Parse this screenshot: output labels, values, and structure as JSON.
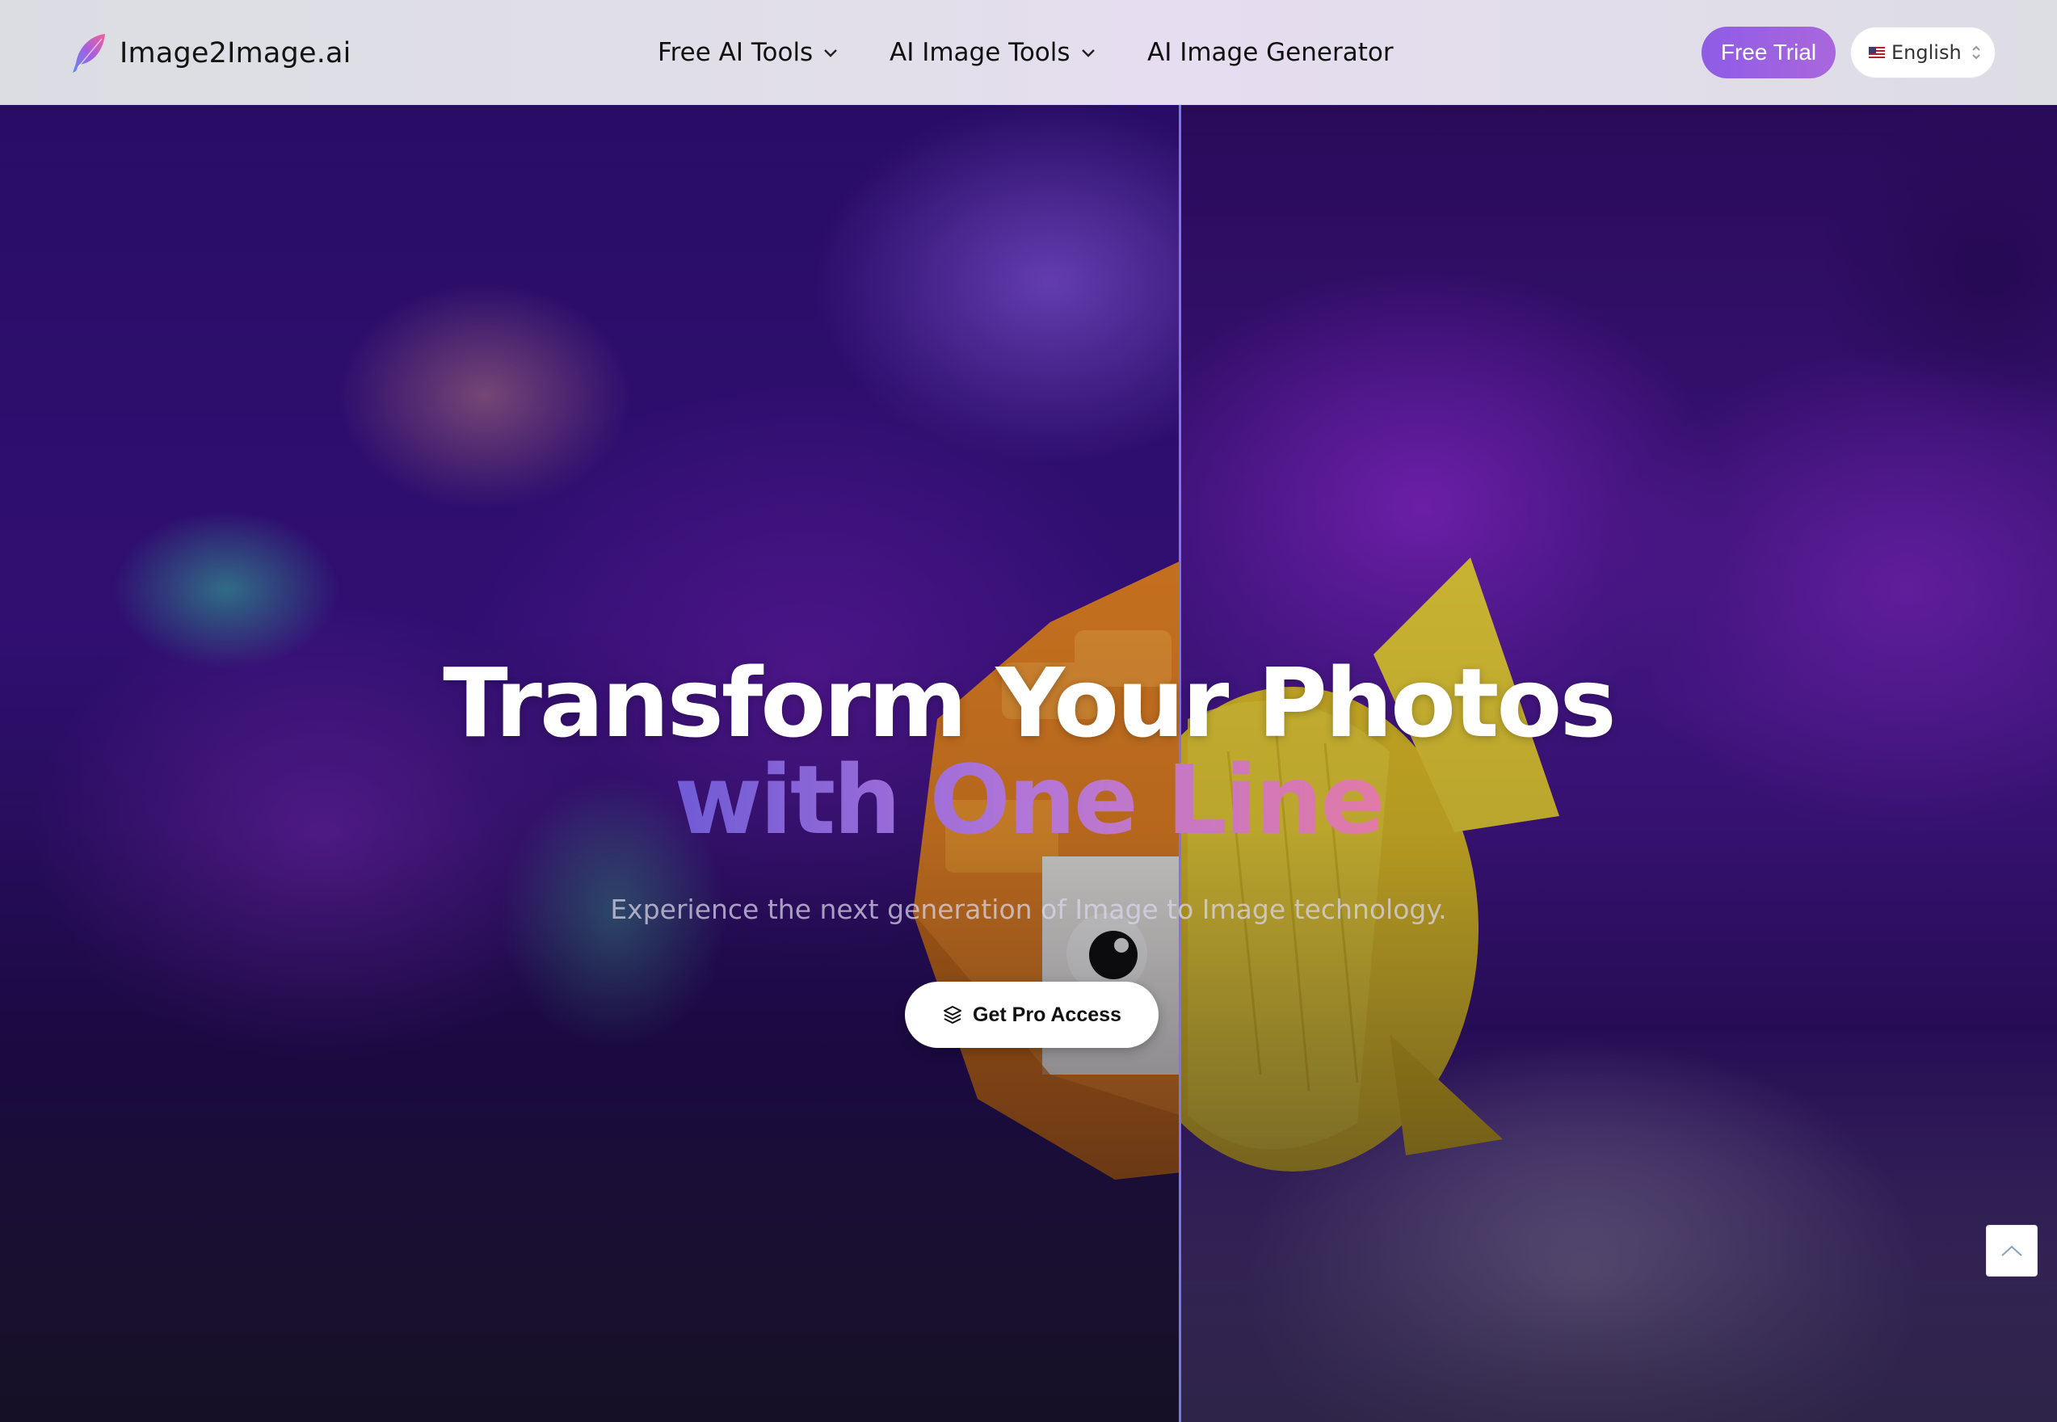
{
  "header": {
    "brand": "Image2Image.ai",
    "nav": [
      {
        "label": "Free AI Tools",
        "icon": "chevron-down-icon"
      },
      {
        "label": "AI Image Tools",
        "icon": "chevron-down-icon"
      },
      {
        "label": "AI Image Generator"
      }
    ],
    "free_trial_label": "Free Trial",
    "language": {
      "selected": "English",
      "flag_icon": "us-flag-icon",
      "icon": "up-down-chevron-icon"
    }
  },
  "hero": {
    "title_line1": "Transform Your Photos",
    "title_line2": "with One Line",
    "subtitle": "Experience the next generation of Image to Image technology.",
    "cta_label": "Get Pro Access",
    "cta_icon": "layers-icon",
    "comparison_slider_position": 0.573
  },
  "scroll_top_icon": "chevron-up-icon",
  "colors": {
    "accent_purple": "#9a60e0",
    "divider": "#7b73f0",
    "title_gradient_start": "#6f5bd6",
    "title_gradient_end": "#e27aa6"
  }
}
